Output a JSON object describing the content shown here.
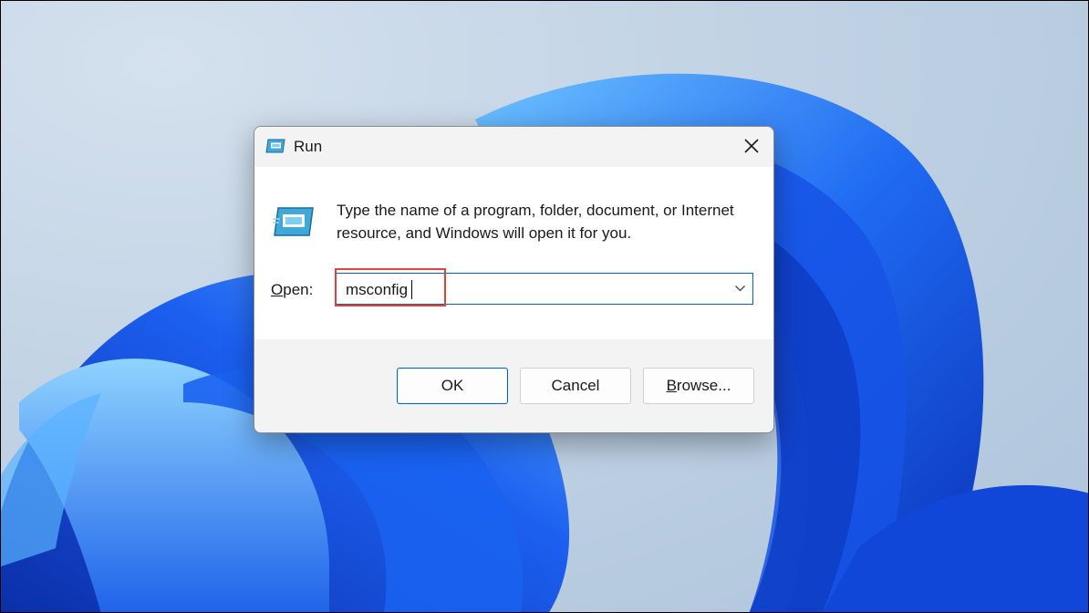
{
  "dialog": {
    "title": "Run",
    "description": "Type the name of a program, folder, document, or Internet resource, and Windows will open it for you.",
    "open_label_prefix": "O",
    "open_label_rest": "pen:",
    "input_value": "msconfig",
    "buttons": {
      "ok": "OK",
      "cancel": "Cancel",
      "browse_prefix": "B",
      "browse_rest": "rowse..."
    }
  },
  "icons": {
    "title": "run-icon",
    "large": "run-icon",
    "close": "close-icon",
    "dropdown": "chevron-down-icon"
  },
  "colors": {
    "accent": "#0067c0",
    "highlight": "#e3413b",
    "wallpaper_blue": "#1a5cf0"
  }
}
